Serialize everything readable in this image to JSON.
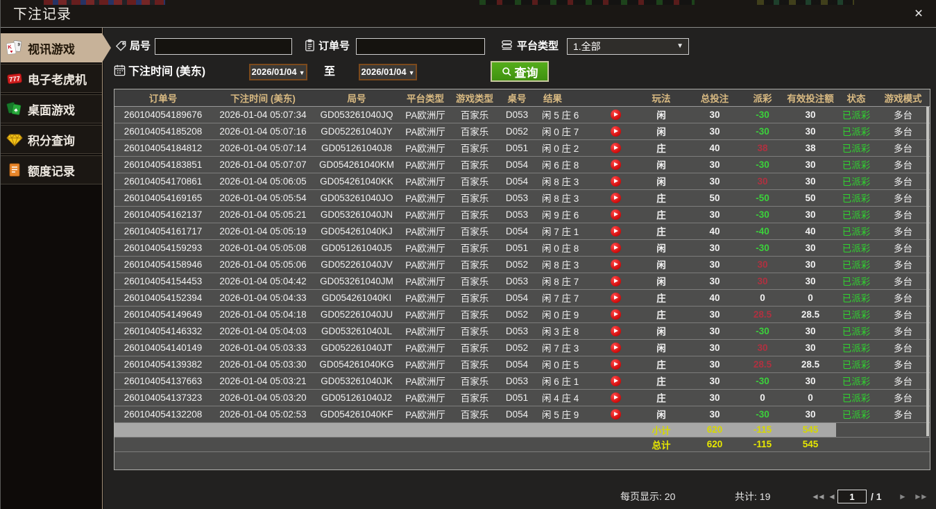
{
  "window": {
    "title": "下注记录",
    "close_label": "×"
  },
  "sidebar": {
    "items": [
      {
        "label": "视讯游戏",
        "icon": "playing-cards-icon",
        "active": true
      },
      {
        "label": "电子老虎机",
        "icon": "slot-777-icon",
        "active": false
      },
      {
        "label": "桌面游戏",
        "icon": "table-games-icon",
        "active": false
      },
      {
        "label": "积分查询",
        "icon": "gem-icon",
        "active": false
      },
      {
        "label": "额度记录",
        "icon": "document-icon",
        "active": false
      }
    ]
  },
  "filters": {
    "round_label": "局号",
    "order_label": "订单号",
    "platform_label": "平台类型",
    "platform_value": "1.全部",
    "bet_time_label": "下注时间 (美东)",
    "date_from": "2026/01/04",
    "date_to": "2026/01/04",
    "to_label": "至",
    "search_label": "查询",
    "dropdown_glyph": "▼"
  },
  "table": {
    "headers": {
      "order_no": "订单号",
      "bet_time": "下注时间 (美东)",
      "round_no": "局号",
      "platform": "平台类型",
      "game_type": "游戏类型",
      "table_no": "桌号",
      "result": "结果",
      "play_icon": "",
      "play": "玩法",
      "total_bet": "总投注",
      "payout": "派彩",
      "valid_bet": "有效投注额",
      "status": "状态",
      "mode": "游戏模式"
    },
    "rows": [
      {
        "order_no": "260104054189676",
        "bet_time": "2026-01-04 05:07:34",
        "round_no": "GD053261040JQ",
        "platform": "PA欧洲厅",
        "game_type": "百家乐",
        "table_no": "D053",
        "result": "闲 5 庄 6",
        "play": "闲",
        "total_bet": "30",
        "payout": "-30",
        "payout_class": "neg",
        "valid_bet": "30",
        "status": "已派彩",
        "mode": "多台"
      },
      {
        "order_no": "260104054185208",
        "bet_time": "2026-01-04 05:07:16",
        "round_no": "GD052261040JY",
        "platform": "PA欧洲厅",
        "game_type": "百家乐",
        "table_no": "D052",
        "result": "闲 0 庄 7",
        "play": "闲",
        "total_bet": "30",
        "payout": "-30",
        "payout_class": "neg",
        "valid_bet": "30",
        "status": "已派彩",
        "mode": "多台"
      },
      {
        "order_no": "260104054184812",
        "bet_time": "2026-01-04 05:07:14",
        "round_no": "GD051261040J8",
        "platform": "PA欧洲厅",
        "game_type": "百家乐",
        "table_no": "D051",
        "result": "闲 0 庄 2",
        "play": "庄",
        "total_bet": "40",
        "payout": "38",
        "payout_class": "pos",
        "valid_bet": "38",
        "status": "已派彩",
        "mode": "多台"
      },
      {
        "order_no": "260104054183851",
        "bet_time": "2026-01-04 05:07:07",
        "round_no": "GD054261040KM",
        "platform": "PA欧洲厅",
        "game_type": "百家乐",
        "table_no": "D054",
        "result": "闲 6 庄 8",
        "play": "闲",
        "total_bet": "30",
        "payout": "-30",
        "payout_class": "neg",
        "valid_bet": "30",
        "status": "已派彩",
        "mode": "多台"
      },
      {
        "order_no": "260104054170861",
        "bet_time": "2026-01-04 05:06:05",
        "round_no": "GD054261040KK",
        "platform": "PA欧洲厅",
        "game_type": "百家乐",
        "table_no": "D054",
        "result": "闲 8 庄 3",
        "play": "闲",
        "total_bet": "30",
        "payout": "30",
        "payout_class": "pos",
        "valid_bet": "30",
        "status": "已派彩",
        "mode": "多台"
      },
      {
        "order_no": "260104054169165",
        "bet_time": "2026-01-04 05:05:54",
        "round_no": "GD053261040JO",
        "platform": "PA欧洲厅",
        "game_type": "百家乐",
        "table_no": "D053",
        "result": "闲 8 庄 3",
        "play": "庄",
        "total_bet": "50",
        "payout": "-50",
        "payout_class": "neg",
        "valid_bet": "50",
        "status": "已派彩",
        "mode": "多台"
      },
      {
        "order_no": "260104054162137",
        "bet_time": "2026-01-04 05:05:21",
        "round_no": "GD053261040JN",
        "platform": "PA欧洲厅",
        "game_type": "百家乐",
        "table_no": "D053",
        "result": "闲 9 庄 6",
        "play": "庄",
        "total_bet": "30",
        "payout": "-30",
        "payout_class": "neg",
        "valid_bet": "30",
        "status": "已派彩",
        "mode": "多台"
      },
      {
        "order_no": "260104054161717",
        "bet_time": "2026-01-04 05:05:19",
        "round_no": "GD054261040KJ",
        "platform": "PA欧洲厅",
        "game_type": "百家乐",
        "table_no": "D054",
        "result": "闲 7 庄 1",
        "play": "庄",
        "total_bet": "40",
        "payout": "-40",
        "payout_class": "neg",
        "valid_bet": "40",
        "status": "已派彩",
        "mode": "多台"
      },
      {
        "order_no": "260104054159293",
        "bet_time": "2026-01-04 05:05:08",
        "round_no": "GD051261040J5",
        "platform": "PA欧洲厅",
        "game_type": "百家乐",
        "table_no": "D051",
        "result": "闲 0 庄 8",
        "play": "闲",
        "total_bet": "30",
        "payout": "-30",
        "payout_class": "neg",
        "valid_bet": "30",
        "status": "已派彩",
        "mode": "多台"
      },
      {
        "order_no": "260104054158946",
        "bet_time": "2026-01-04 05:05:06",
        "round_no": "GD052261040JV",
        "platform": "PA欧洲厅",
        "game_type": "百家乐",
        "table_no": "D052",
        "result": "闲 8 庄 3",
        "play": "闲",
        "total_bet": "30",
        "payout": "30",
        "payout_class": "pos",
        "valid_bet": "30",
        "status": "已派彩",
        "mode": "多台"
      },
      {
        "order_no": "260104054154453",
        "bet_time": "2026-01-04 05:04:42",
        "round_no": "GD053261040JM",
        "platform": "PA欧洲厅",
        "game_type": "百家乐",
        "table_no": "D053",
        "result": "闲 8 庄 7",
        "play": "闲",
        "total_bet": "30",
        "payout": "30",
        "payout_class": "pos",
        "valid_bet": "30",
        "status": "已派彩",
        "mode": "多台"
      },
      {
        "order_no": "260104054152394",
        "bet_time": "2026-01-04 05:04:33",
        "round_no": "GD054261040KI",
        "platform": "PA欧洲厅",
        "game_type": "百家乐",
        "table_no": "D054",
        "result": "闲 7 庄 7",
        "play": "庄",
        "total_bet": "40",
        "payout": "0",
        "payout_class": "zero",
        "valid_bet": "0",
        "status": "已派彩",
        "mode": "多台"
      },
      {
        "order_no": "260104054149649",
        "bet_time": "2026-01-04 05:04:18",
        "round_no": "GD052261040JU",
        "platform": "PA欧洲厅",
        "game_type": "百家乐",
        "table_no": "D052",
        "result": "闲 0 庄 9",
        "play": "庄",
        "total_bet": "30",
        "payout": "28.5",
        "payout_class": "pos",
        "valid_bet": "28.5",
        "status": "已派彩",
        "mode": "多台"
      },
      {
        "order_no": "260104054146332",
        "bet_time": "2026-01-04 05:04:03",
        "round_no": "GD053261040JL",
        "platform": "PA欧洲厅",
        "game_type": "百家乐",
        "table_no": "D053",
        "result": "闲 3 庄 8",
        "play": "闲",
        "total_bet": "30",
        "payout": "-30",
        "payout_class": "neg",
        "valid_bet": "30",
        "status": "已派彩",
        "mode": "多台"
      },
      {
        "order_no": "260104054140149",
        "bet_time": "2026-01-04 05:03:33",
        "round_no": "GD052261040JT",
        "platform": "PA欧洲厅",
        "game_type": "百家乐",
        "table_no": "D052",
        "result": "闲 7 庄 3",
        "play": "闲",
        "total_bet": "30",
        "payout": "30",
        "payout_class": "pos",
        "valid_bet": "30",
        "status": "已派彩",
        "mode": "多台"
      },
      {
        "order_no": "260104054139382",
        "bet_time": "2026-01-04 05:03:30",
        "round_no": "GD054261040KG",
        "platform": "PA欧洲厅",
        "game_type": "百家乐",
        "table_no": "D054",
        "result": "闲 0 庄 5",
        "play": "庄",
        "total_bet": "30",
        "payout": "28.5",
        "payout_class": "pos",
        "valid_bet": "28.5",
        "status": "已派彩",
        "mode": "多台"
      },
      {
        "order_no": "260104054137663",
        "bet_time": "2026-01-04 05:03:21",
        "round_no": "GD053261040JK",
        "platform": "PA欧洲厅",
        "game_type": "百家乐",
        "table_no": "D053",
        "result": "闲 6 庄 1",
        "play": "庄",
        "total_bet": "30",
        "payout": "-30",
        "payout_class": "neg",
        "valid_bet": "30",
        "status": "已派彩",
        "mode": "多台"
      },
      {
        "order_no": "260104054137323",
        "bet_time": "2026-01-04 05:03:20",
        "round_no": "GD051261040J2",
        "platform": "PA欧洲厅",
        "game_type": "百家乐",
        "table_no": "D051",
        "result": "闲 4 庄 4",
        "play": "庄",
        "total_bet": "30",
        "payout": "0",
        "payout_class": "zero",
        "valid_bet": "0",
        "status": "已派彩",
        "mode": "多台"
      },
      {
        "order_no": "260104054132208",
        "bet_time": "2026-01-04 05:02:53",
        "round_no": "GD054261040KF",
        "platform": "PA欧洲厅",
        "game_type": "百家乐",
        "table_no": "D054",
        "result": "闲 5 庄 9",
        "play": "闲",
        "total_bet": "30",
        "payout": "-30",
        "payout_class": "neg",
        "valid_bet": "30",
        "status": "已派彩",
        "mode": "多台"
      }
    ],
    "subtotal": {
      "label": "小计",
      "total_bet": "620",
      "payout": "-115",
      "valid_bet": "545"
    },
    "total": {
      "label": "总计",
      "total_bet": "620",
      "payout": "-115",
      "valid_bet": "545"
    }
  },
  "pagination": {
    "per_page_label": "每页显示: 20",
    "total_label": "共计: 19",
    "page": "1",
    "of_label": "/  1",
    "first_glyph": "◄◄",
    "prev_glyph": "◄",
    "next_glyph": "►",
    "last_glyph": "►►"
  },
  "colors": {
    "active_tab_tan": "#c7b299",
    "header_gold": "#d9ba82",
    "win_red": "#b03140",
    "loss_green": "#3bd23b",
    "status_green": "#2fd42f",
    "total_yellow": "#e8e900",
    "button_green": "#4aa41a"
  }
}
